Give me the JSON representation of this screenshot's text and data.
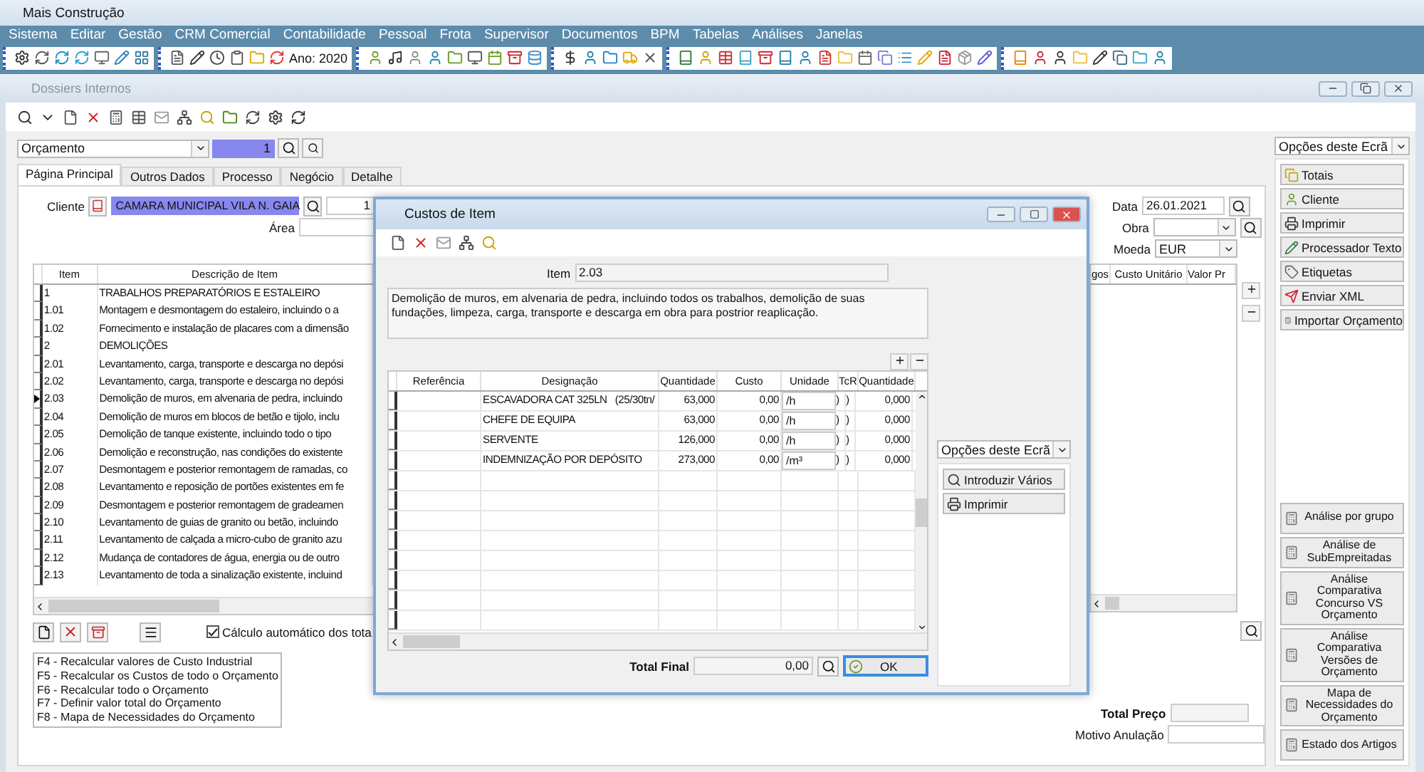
{
  "app": {
    "title": "Mais Construção"
  },
  "menu": [
    "Sistema",
    "Editar",
    "Gestão",
    "CRM Comercial",
    "Contabilidade",
    "Pessoal",
    "Frota",
    "Supervisor",
    "Documentos",
    "BPM",
    "Tabelas",
    "Análises",
    "Janelas"
  ],
  "toolbar": {
    "year_button": "Ano: 2020"
  },
  "document_window": {
    "title": "Dossiers Internos",
    "doc_type": {
      "value": "Orçamento"
    },
    "number": {
      "value": "1"
    },
    "tabs": [
      {
        "label": "Página Principal",
        "selected": true
      },
      {
        "label": "Outros Dados",
        "selected": false
      },
      {
        "label": "Processo",
        "selected": false
      },
      {
        "label": "Negócio",
        "selected": false
      },
      {
        "label": "Detalhe",
        "selected": false
      }
    ],
    "client": {
      "label": "Cliente",
      "value": "CAMARA MUNICIPAL VILA N. GAIA",
      "code": "1"
    },
    "area": {
      "label": "Área"
    },
    "date": {
      "label": "Data",
      "value": "26.01.2021"
    },
    "obra": {
      "label": "Obra"
    },
    "currency": {
      "label": "Moeda",
      "value": "EUR"
    },
    "items_table": {
      "columns": [
        "Item",
        "Descrição de Item"
      ],
      "right_columns": [
        "gos",
        "Custo Unitário",
        "Valor Pr"
      ],
      "rows": [
        {
          "item": "1",
          "description": "TRABALHOS PREPARATÓRIOS E ESTALEIRO",
          "selected": false
        },
        {
          "item": "1.01",
          "description": "Montagem e desmontagem do estaleiro, incluindo o a",
          "selected": false
        },
        {
          "item": "1.02",
          "description": "Fornecimento e instalação de placares com a dimensão",
          "selected": false
        },
        {
          "item": "2",
          "description": "DEMOLIÇÕES",
          "selected": false
        },
        {
          "item": "2.01",
          "description": "Levantamento, carga, transporte e descarga no depósi",
          "selected": false
        },
        {
          "item": "2.02",
          "description": "Levantamento, carga, transporte e descarga no depósi",
          "selected": false
        },
        {
          "item": "2.03",
          "description": "Demolição de muros, em alvenaria de pedra, incluindo",
          "selected": true
        },
        {
          "item": "2.04",
          "description": "Demolição de muros em blocos de betão e tijolo, inclu",
          "selected": false
        },
        {
          "item": "2.05",
          "description": "Demolição de tanque existente, incluindo todo o tipo",
          "selected": false
        },
        {
          "item": "2.06",
          "description": "Demolição e reconstrução, nas condições do existente",
          "selected": false
        },
        {
          "item": "2.07",
          "description": "Desmontagem e posterior remontagem de ramadas, co",
          "selected": false
        },
        {
          "item": "2.08",
          "description": "Levantamento e reposição de portões existentes em fe",
          "selected": false
        },
        {
          "item": "2.09",
          "description": "Desmontagem e posterior remontagem de gradeamen",
          "selected": false
        },
        {
          "item": "2.10",
          "description": "Levantamento de guias de granito ou betão, incluindo",
          "selected": false
        },
        {
          "item": "2.11",
          "description": "Levantamento de calçada a micro-cubo de granito azu",
          "selected": false
        },
        {
          "item": "2.12",
          "description": "Mudança de contadores de água, energia ou de outro",
          "selected": false
        },
        {
          "item": "2.13",
          "description": "Levantamento de toda a sinalização existente, incluind",
          "selected": false
        }
      ]
    },
    "auto_calc": {
      "label": "Cálculo automático dos tota",
      "checked": true
    },
    "shortcuts": [
      "F4 - Recalcular valores de Custo Industrial",
      "F5 - Recalcular os Custos de todo o Orçamento",
      "F6 - Recalcular todo o Orçamento",
      "F7 - Definir valor total do Orçamento",
      "F8 - Mapa de Necessidades do Orçamento"
    ],
    "total_price": {
      "label": "Total Preço"
    },
    "cancel_reason": {
      "label": "Motivo Anulação"
    }
  },
  "side_panel": {
    "options": "Opções deste Ecrã",
    "actions": [
      {
        "label": "Totais",
        "kind": "totals"
      },
      {
        "label": "Cliente",
        "kind": "client"
      },
      {
        "label": "Imprimir",
        "kind": "print"
      },
      {
        "label": "Processador Texto",
        "kind": "text"
      },
      {
        "label": "Etiquetas",
        "kind": "labels"
      },
      {
        "label": "Enviar XML",
        "kind": "send"
      },
      {
        "label": "Importar Orçamento",
        "kind": "import"
      }
    ],
    "analyses": [
      "Análise por grupo",
      "Análise de SubEmpreitadas",
      "Análise Comparativa Concurso VS Orçamento",
      "Análise Comparativa Versões de Orçamento",
      "Mapa de Necessidades do Orçamento",
      "Estado dos Artigos"
    ]
  },
  "dialog": {
    "title": "Custos de Item",
    "item": {
      "label": "Item",
      "value": "2.03"
    },
    "description": "Demolição de muros, em alvenaria de pedra, incluindo todos os trabalhos, demolição de suas fundações, limpeza, carga, transporte e descarga em obra para postrior reaplicação.",
    "columns": [
      "Referência",
      "Designação",
      "Quantidade",
      "Custo",
      "Unidade",
      "TcR",
      "Quantidade"
    ],
    "rows": [
      {
        "designation": "ESCAVADORA CAT 325LN   (25/30tn/",
        "quantity": "63,000",
        "cost": "0,00",
        "unit": "/h",
        "t": ")",
        "r": ")",
        "quantity2": "0,000"
      },
      {
        "designation": "CHEFE DE EQUIPA",
        "quantity": "63,000",
        "cost": "0,00",
        "unit": "/h",
        "t": ")",
        "r": ")",
        "quantity2": "0,000"
      },
      {
        "designation": "SERVENTE",
        "quantity": "126,000",
        "cost": "0,00",
        "unit": "/h",
        "t": ")",
        "r": ")",
        "quantity2": "0,000"
      },
      {
        "designation": "INDEMNIZAÇÃO POR DEPÓSITO",
        "quantity": "273,000",
        "cost": "0,00",
        "unit": "/m³",
        "t": ")",
        "r": ")",
        "quantity2": "0,000"
      }
    ],
    "options": "Opções deste Ecrã",
    "option_buttons": [
      {
        "label": "Introduzir Vários",
        "kind": "search"
      },
      {
        "label": "Imprimir",
        "kind": "print"
      }
    ],
    "total": {
      "label": "Total Final",
      "value": "0,00"
    },
    "ok_button": "OK"
  }
}
